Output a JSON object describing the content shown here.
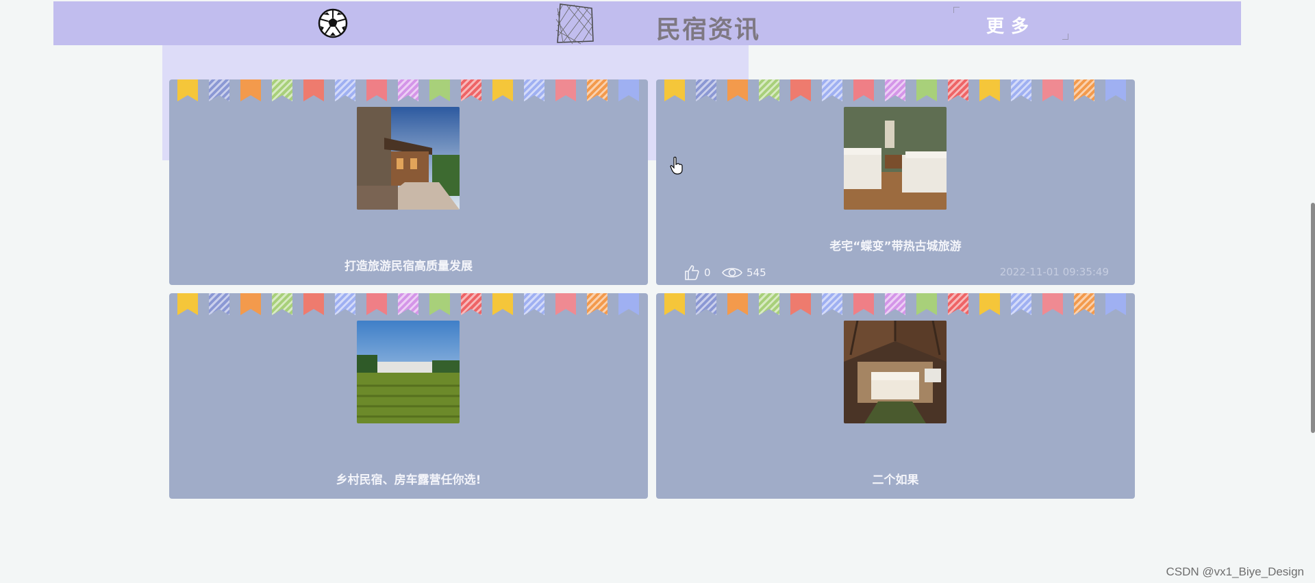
{
  "header": {
    "title": "民宿资讯",
    "more_label": "更多"
  },
  "flag_colors": [
    "#f5c63a",
    "#8b98d4",
    "#f39a4c",
    "#a8d07a",
    "#ee7b6e",
    "#9fb0f2",
    "#ef7f86",
    "#d495e8",
    "#a8d07a",
    "#ee6466",
    "#f5c63a",
    "#9fb0f2",
    "#ef8a92",
    "#f39a4c",
    "#9fb0f2"
  ],
  "cards": [
    {
      "title": "打造旅游民宿高质量发展"
    },
    {
      "title": "老宅“蝶变”带热古城旅游",
      "likes": "0",
      "views": "545",
      "date": "2022-11-01 09:35:49"
    },
    {
      "title": "乡村民宿、房车露营任你选!"
    },
    {
      "title": "二个如果"
    }
  ],
  "watermark": "CSDN @vx1_Biye_Design"
}
